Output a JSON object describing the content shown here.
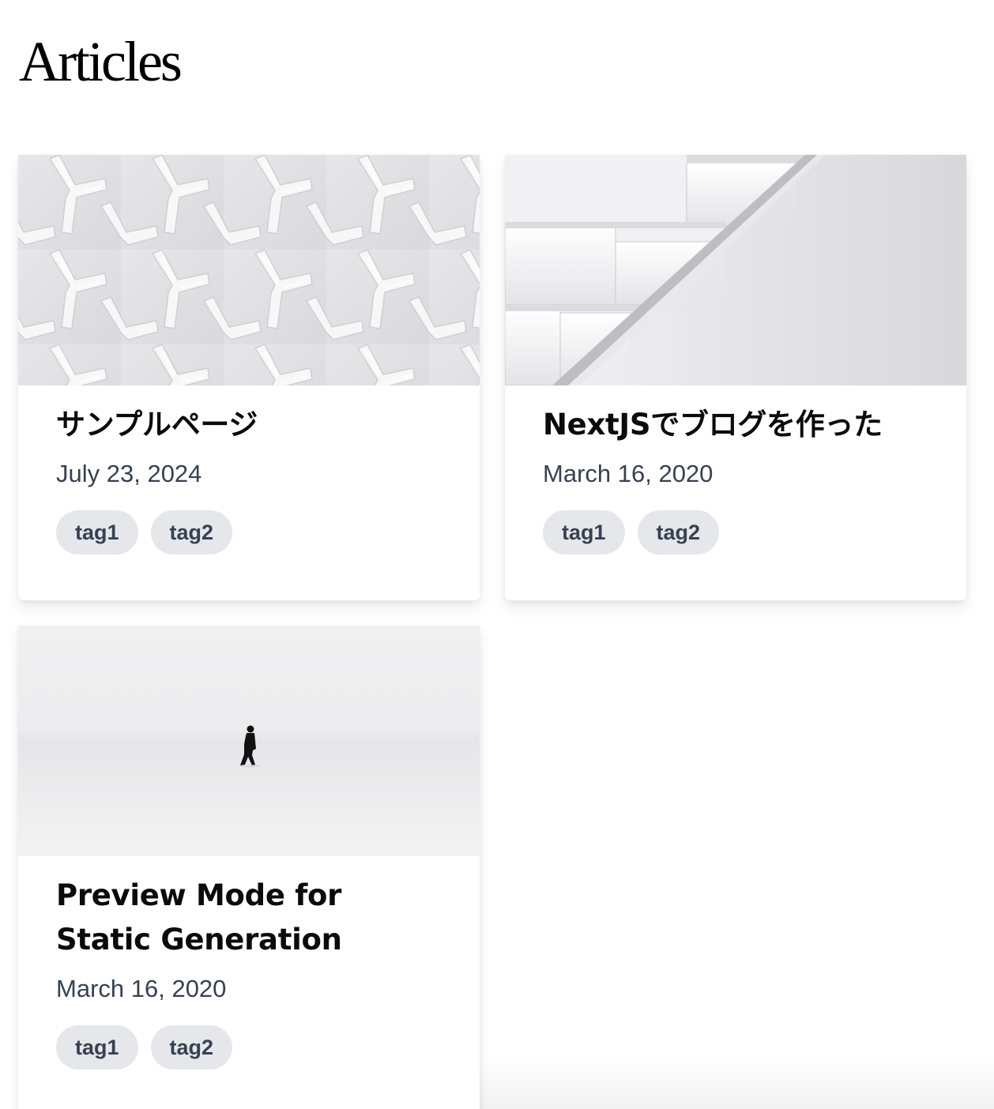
{
  "page": {
    "title": "Articles"
  },
  "articles": [
    {
      "title": "サンプルページ",
      "date": "July 23, 2024",
      "image": "white-lattice-architecture",
      "tags": [
        "tag1",
        "tag2"
      ]
    },
    {
      "title": "NextJSでブログを作った",
      "date": "March 16, 2020",
      "image": "white-staircase-architecture",
      "tags": [
        "tag1",
        "tag2"
      ]
    },
    {
      "title": "Preview Mode for Static Generation",
      "date": "March 16, 2020",
      "image": "person-walking-on-white-snow",
      "tags": [
        "tag1",
        "tag2"
      ]
    }
  ],
  "colors": {
    "tag_background": "#e5e7eb",
    "tag_text": "#374151",
    "date_text": "#374151",
    "title_text": "#0b0b0b"
  }
}
